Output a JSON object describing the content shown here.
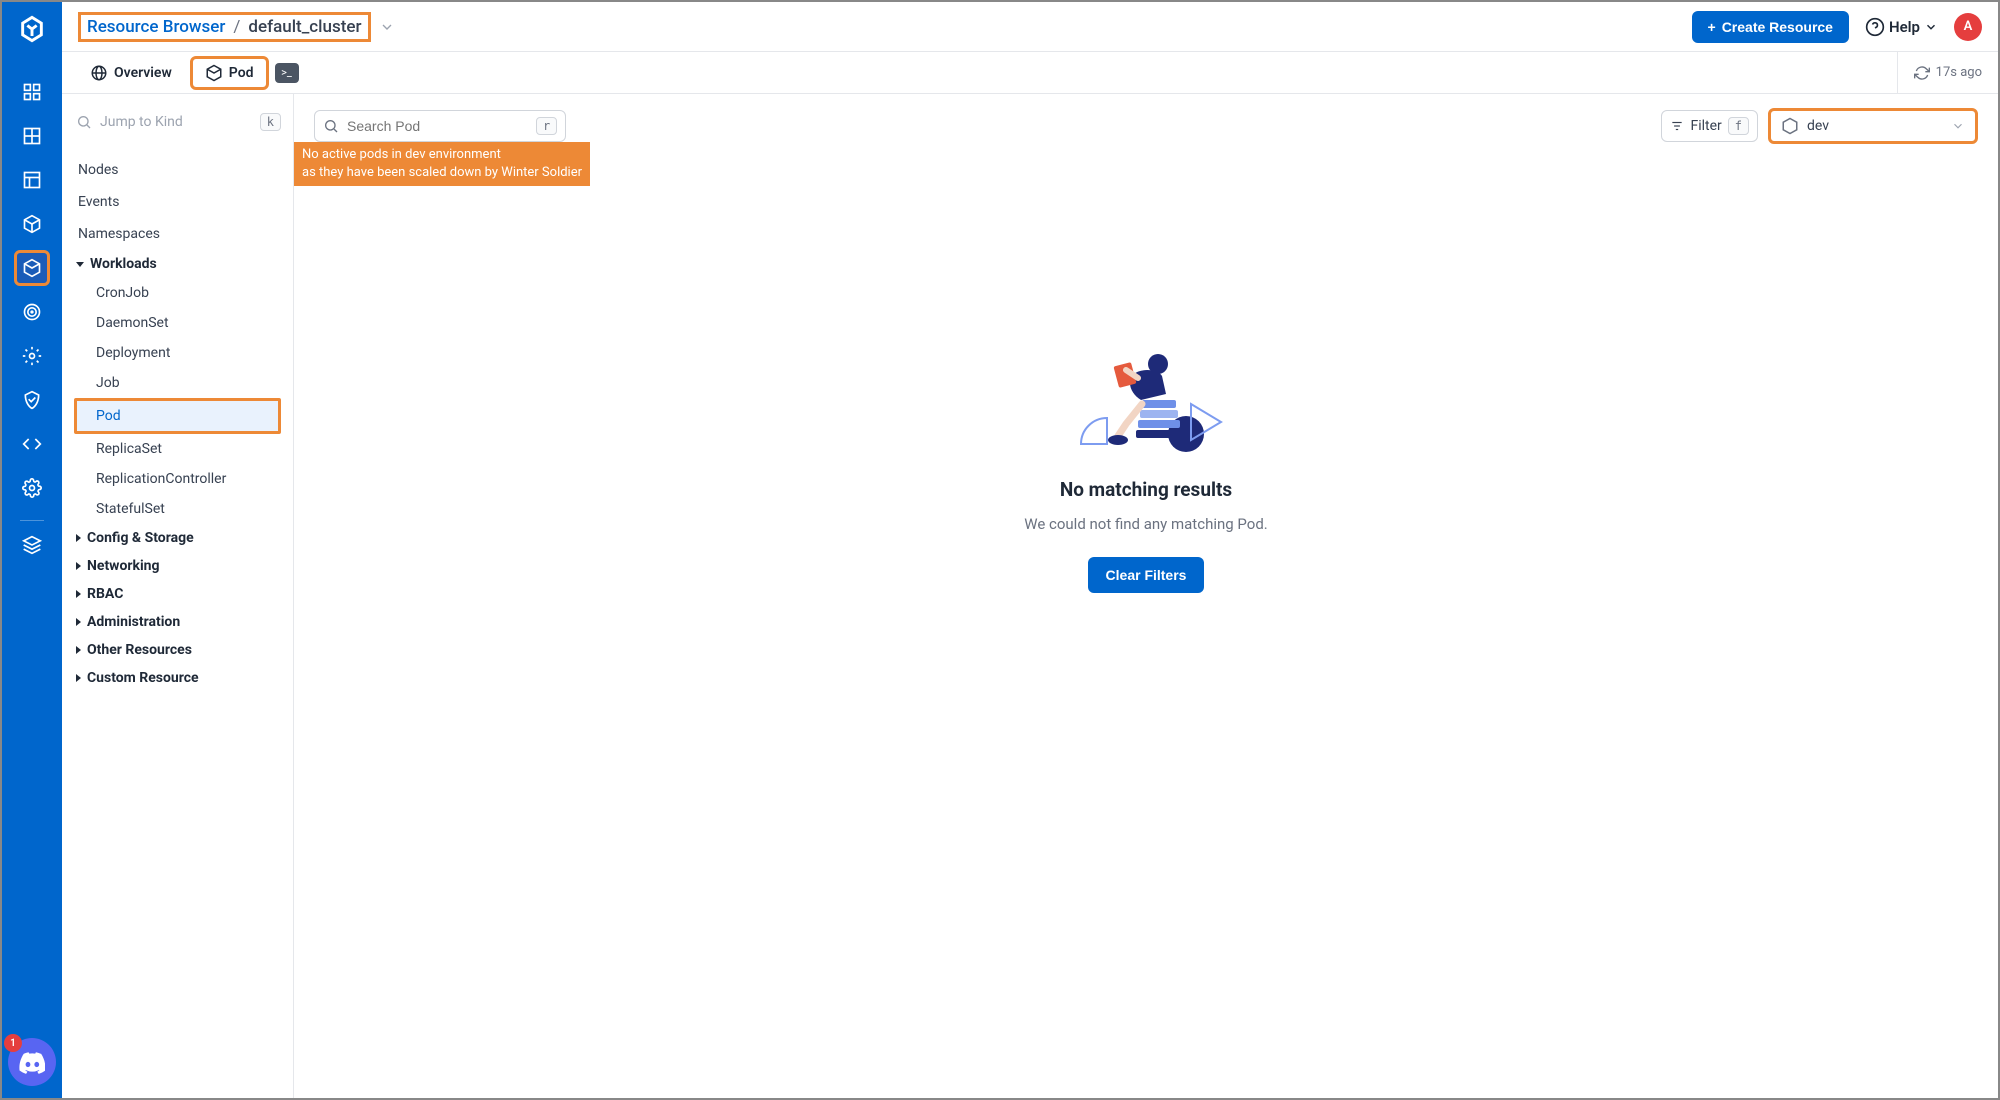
{
  "header": {
    "breadcrumb_root": "Resource Browser",
    "breadcrumb_current": "default_cluster",
    "create_btn": "Create Resource",
    "help": "Help",
    "avatar_letter": "A"
  },
  "tabs": {
    "overview": "Overview",
    "pod": "Pod",
    "refresh_age": "17s ago"
  },
  "sidebar": {
    "kind_placeholder": "Jump to Kind",
    "kind_key": "k",
    "items": {
      "nodes": "Nodes",
      "events": "Events",
      "namespaces": "Namespaces"
    },
    "workloads": {
      "title": "Workloads",
      "cronjob": "CronJob",
      "daemonset": "DaemonSet",
      "deployment": "Deployment",
      "job": "Job",
      "pod": "Pod",
      "replicaset": "ReplicaSet",
      "rc": "ReplicationController",
      "statefulset": "StatefulSet"
    },
    "sections": {
      "config": "Config & Storage",
      "networking": "Networking",
      "rbac": "RBAC",
      "admin": "Administration",
      "other": "Other Resources",
      "custom": "Custom Resource"
    }
  },
  "toolbar": {
    "search_placeholder": "Search Pod",
    "search_key": "r",
    "filter": "Filter",
    "filter_key": "f",
    "namespace": "dev"
  },
  "annotation": {
    "line1": "No active pods in dev environment",
    "line2": "as they have been scaled down by Winter Soldier"
  },
  "empty": {
    "title": "No matching results",
    "subtitle": "We could not find any matching Pod.",
    "clear": "Clear Filters"
  },
  "discord_badge": "1"
}
